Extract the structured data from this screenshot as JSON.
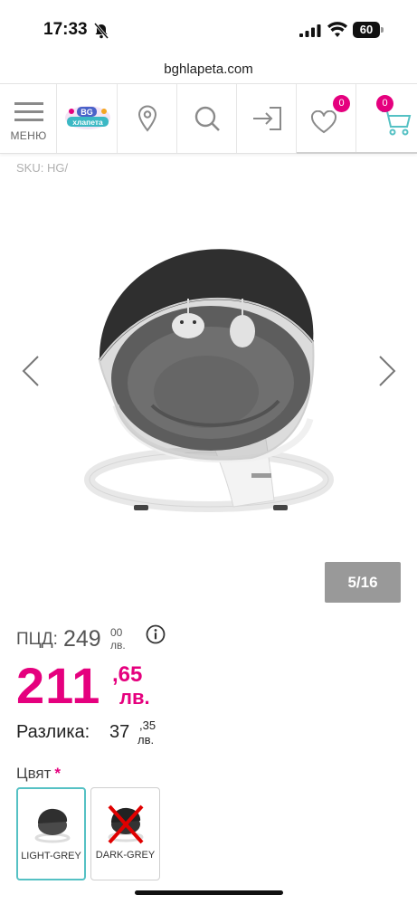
{
  "status_bar": {
    "time": "17:33",
    "battery": "60",
    "icons": [
      "bell-slash-icon",
      "cellular-signal-icon",
      "wifi-icon",
      "battery-icon"
    ]
  },
  "browser": {
    "url": "bghlapeta.com"
  },
  "header": {
    "menu_label": "МЕНЮ",
    "logo_text": "BG хлапета",
    "wishlist_count": "0",
    "cart_count": "0",
    "icons": [
      "hamburger-menu-icon",
      "location-pin-icon",
      "search-icon",
      "login-icon",
      "heart-icon",
      "cart-icon"
    ]
  },
  "product": {
    "sku": "SKU: HG/",
    "gallery_counter": "5/16",
    "rrp_label": "ПЦД:",
    "rrp_int": "249",
    "rrp_dec": "00",
    "rrp_currency": "лв.",
    "price_int": "211",
    "price_dec": ",65",
    "price_currency": "лв.",
    "diff_label": "Разлика:",
    "diff_int": "37",
    "diff_dec": ",35",
    "diff_currency": "лв.",
    "color_label": "Цвят",
    "color_required": "*",
    "colors": [
      {
        "label": "LIGHT-GREY",
        "selected": true,
        "available": true
      },
      {
        "label": "DARK-GREY",
        "selected": false,
        "available": false
      }
    ]
  },
  "colors": {
    "accent": "#e5007e",
    "selected_border": "#55c1c4",
    "counter_bg": "#999999"
  }
}
